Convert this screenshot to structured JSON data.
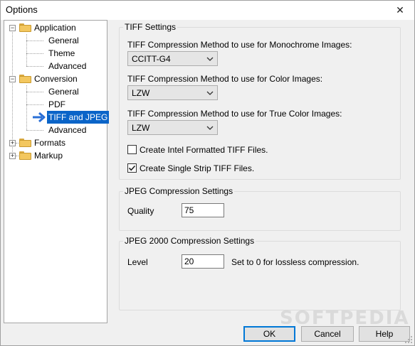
{
  "window": {
    "title": "Options",
    "close_glyph": "✕"
  },
  "tree": {
    "items": [
      {
        "label": "Application"
      },
      {
        "label": "General"
      },
      {
        "label": "Theme"
      },
      {
        "label": "Advanced"
      },
      {
        "label": "Conversion"
      },
      {
        "label": "General"
      },
      {
        "label": "PDF"
      },
      {
        "label": "TIFF and JPEG",
        "selected": true
      },
      {
        "label": "Advanced"
      },
      {
        "label": "Formats"
      },
      {
        "label": "Markup"
      }
    ],
    "collapse_glyph": "−",
    "expand_glyph": "+"
  },
  "tiff": {
    "title": "TIFF Settings",
    "mono_label": "TIFF Compression Method to use for Monochrome Images:",
    "mono_value": "CCITT-G4",
    "color_label": "TIFF Compression Method to use for Color Images:",
    "color_value": "LZW",
    "truecolor_label": "TIFF Compression Method to use for True Color Images:",
    "truecolor_value": "LZW",
    "intel_label": "Create Intel Formatted TIFF Files.",
    "intel_checked": false,
    "strip_label": "Create Single Strip TIFF Files.",
    "strip_checked": true
  },
  "jpeg": {
    "title": "JPEG Compression Settings",
    "quality_label": "Quality",
    "quality_value": "75"
  },
  "jpeg2000": {
    "title": "JPEG 2000 Compression Settings",
    "level_label": "Level",
    "level_value": "20",
    "hint": "Set to 0 for lossless compression."
  },
  "buttons": {
    "ok": "OK",
    "cancel": "Cancel",
    "help": "Help"
  },
  "watermark": "SOFTPEDIA",
  "colors": {
    "selection": "#0a64c8",
    "folder": "#f3c75f",
    "arrow": "#2a6fd6",
    "default_border": "#0078d7"
  }
}
